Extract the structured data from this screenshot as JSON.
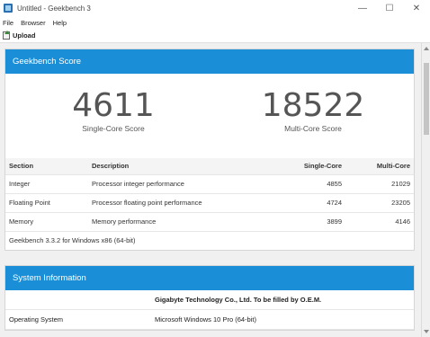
{
  "window": {
    "title": "Untitled - Geekbench 3",
    "controls": {
      "minimize": "—",
      "maximize": "☐",
      "close": "✕"
    }
  },
  "menu": [
    "File",
    "Browser",
    "Help"
  ],
  "toolbar": {
    "upload_label": "Upload"
  },
  "score_card": {
    "header": "Geekbench Score",
    "single_core": {
      "value": "4611",
      "label": "Single-Core Score"
    },
    "multi_core": {
      "value": "18522",
      "label": "Multi-Core Score"
    },
    "columns": [
      "Section",
      "Description",
      "Single-Core",
      "Multi-Core"
    ],
    "rows": [
      {
        "section": "Integer",
        "description": "Processor integer performance",
        "single": "4855",
        "multi": "21029"
      },
      {
        "section": "Floating Point",
        "description": "Processor floating point performance",
        "single": "4724",
        "multi": "23205"
      },
      {
        "section": "Memory",
        "description": "Memory performance",
        "single": "3899",
        "multi": "4146"
      }
    ],
    "footer": "Geekbench 3.3.2 for Windows x86 (64-bit)"
  },
  "system_card": {
    "header": "System Information",
    "model": "Gigabyte Technology Co., Ltd. To be filled by O.E.M.",
    "rows": [
      {
        "label": "Operating System",
        "value": "Microsoft Windows 10 Pro (64-bit)"
      }
    ]
  },
  "colors": {
    "accent": "#1a8fd8"
  }
}
